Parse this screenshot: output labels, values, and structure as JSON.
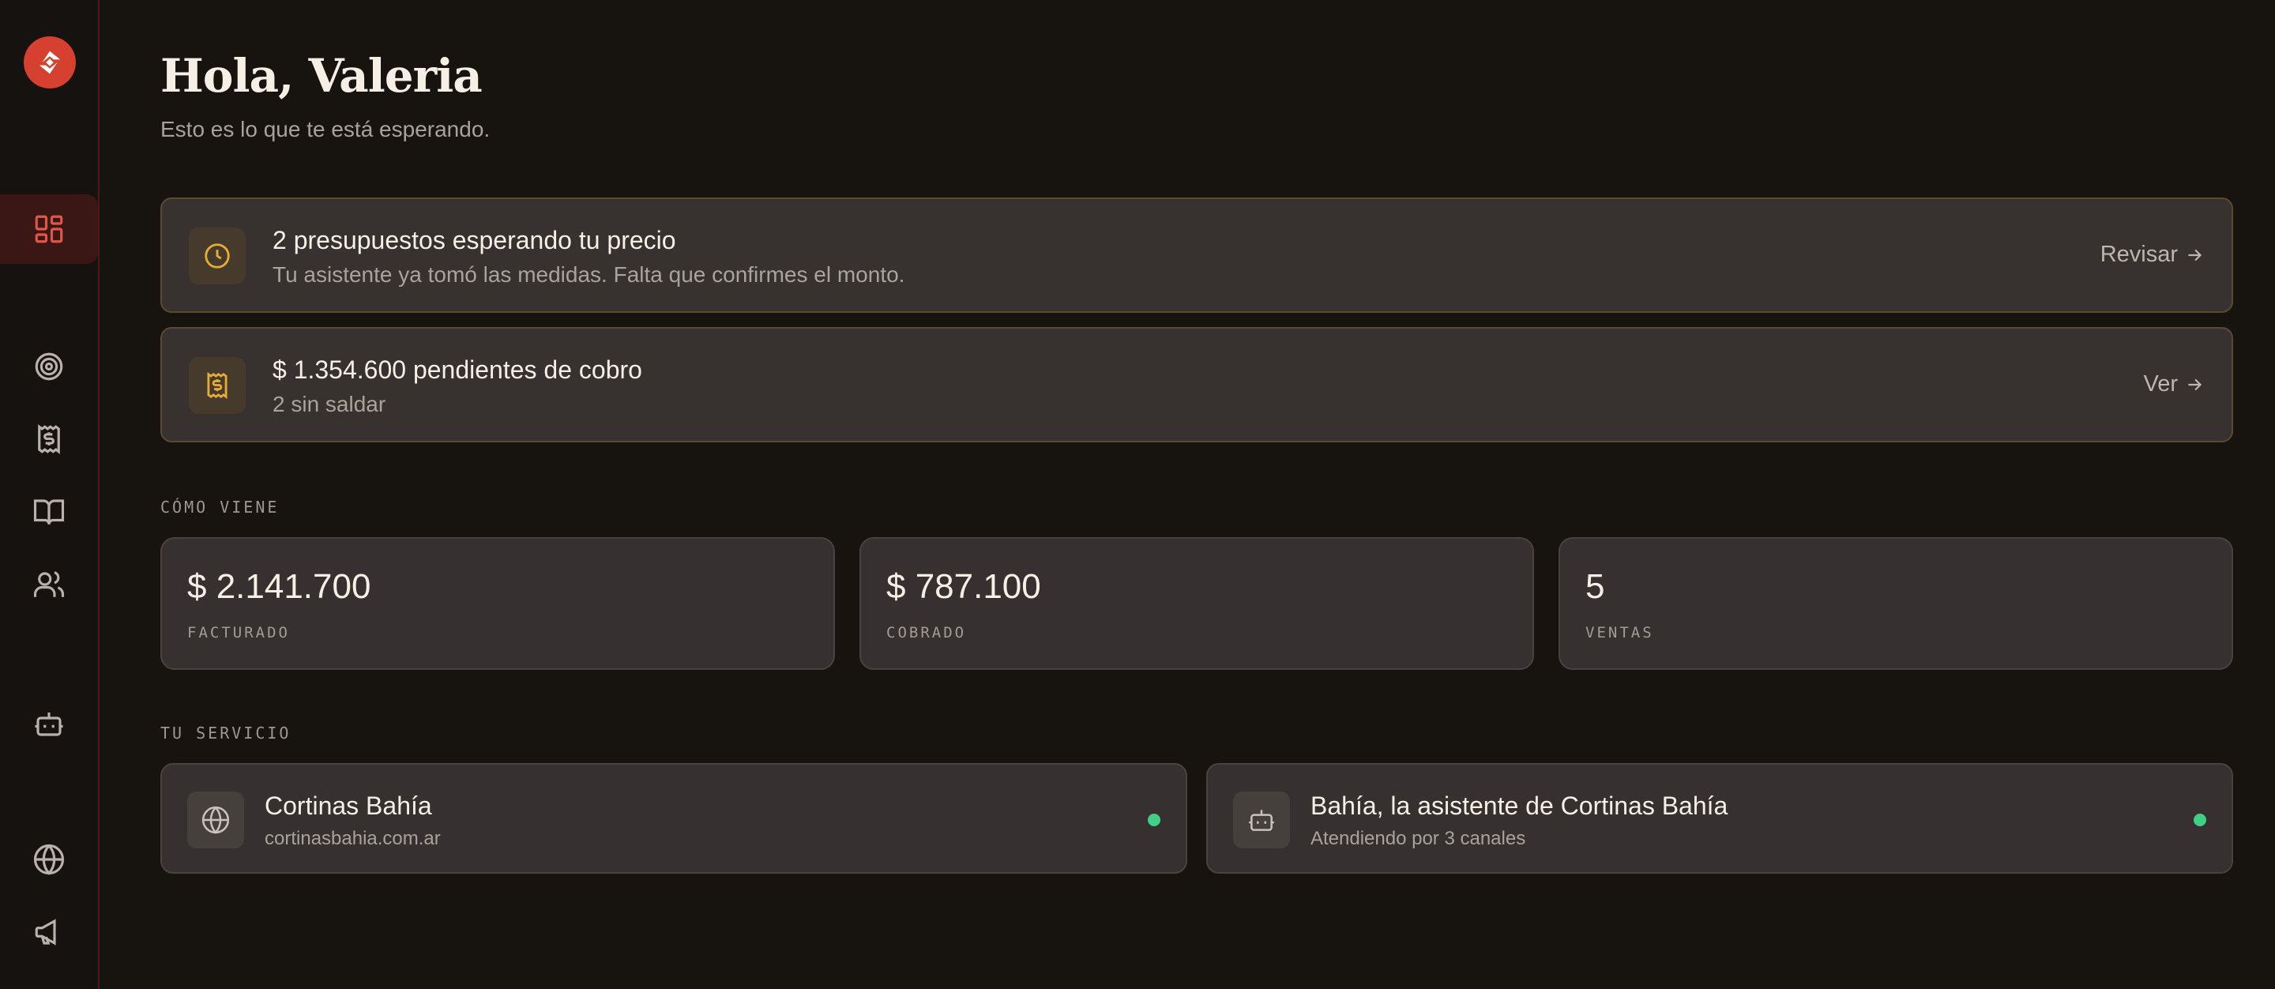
{
  "header": {
    "greeting": "Hola, Valeria",
    "subtitle": "Esto es lo que te está esperando."
  },
  "sidebar": {
    "items": [
      {
        "icon": "dashboard-icon",
        "active": true
      },
      {
        "icon": "target-icon",
        "active": false
      },
      {
        "icon": "receipt-icon",
        "active": false
      },
      {
        "icon": "book-icon",
        "active": false
      },
      {
        "icon": "users-icon",
        "active": false
      },
      {
        "icon": "bot-icon",
        "active": false
      },
      {
        "icon": "globe-icon",
        "active": false
      },
      {
        "icon": "megaphone-icon",
        "active": false
      }
    ]
  },
  "alerts": [
    {
      "icon": "clock-icon",
      "title": "2 presupuestos esperando tu precio",
      "subtitle": "Tu asistente ya tomó las medidas. Falta que confirmes el monto.",
      "action": "Revisar"
    },
    {
      "icon": "receipt-icon",
      "title": "$ 1.354.600 pendientes de cobro",
      "subtitle": "2 sin saldar",
      "action": "Ver"
    }
  ],
  "stats": {
    "section_label": "CÓMO VIENE",
    "items": [
      {
        "value": "$ 2.141.700",
        "label": "FACTURADO"
      },
      {
        "value": "$ 787.100",
        "label": "COBRADO"
      },
      {
        "value": "5",
        "label": "VENTAS"
      }
    ]
  },
  "service": {
    "section_label": "TU SERVICIO",
    "items": [
      {
        "icon": "globe-icon",
        "title": "Cortinas Bahía",
        "subtitle": "cortinasbahia.com.ar",
        "status": "online"
      },
      {
        "icon": "bot-icon",
        "title": "Bahía, la asistente de Cortinas Bahía",
        "subtitle": "Atendiendo por 3 canales",
        "status": "online"
      }
    ]
  },
  "colors": {
    "accent": "#d6402e",
    "warning": "#e7ac35",
    "online": "#3fcf86",
    "background": "#16130f",
    "card": "#373130"
  }
}
